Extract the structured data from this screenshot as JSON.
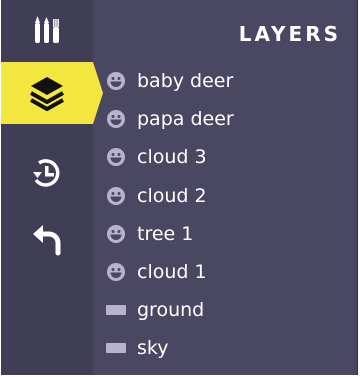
{
  "panel": {
    "title": "LAYERS"
  },
  "toolbar": {
    "tools": [
      {
        "name": "art-tools-icon"
      },
      {
        "name": "layers-icon",
        "active": true
      },
      {
        "name": "history-icon"
      },
      {
        "name": "undo-icon"
      }
    ]
  },
  "layers": [
    {
      "label": "baby deer",
      "icon": "sprite-face-icon"
    },
    {
      "label": "papa deer",
      "icon": "sprite-face-icon"
    },
    {
      "label": "cloud 3",
      "icon": "sprite-face-icon"
    },
    {
      "label": "cloud 2",
      "icon": "sprite-face-icon"
    },
    {
      "label": "tree 1",
      "icon": "sprite-face-icon"
    },
    {
      "label": "cloud 1",
      "icon": "sprite-face-icon"
    },
    {
      "label": "ground",
      "icon": "rectangle-icon"
    },
    {
      "label": "sky",
      "icon": "rectangle-icon"
    }
  ],
  "colors": {
    "panel_bg": "#4a4762",
    "toolbar_bg": "#403d56",
    "active_accent": "#f3e63f",
    "icon_fill": "#b8b2cf",
    "text": "#ffffff"
  }
}
